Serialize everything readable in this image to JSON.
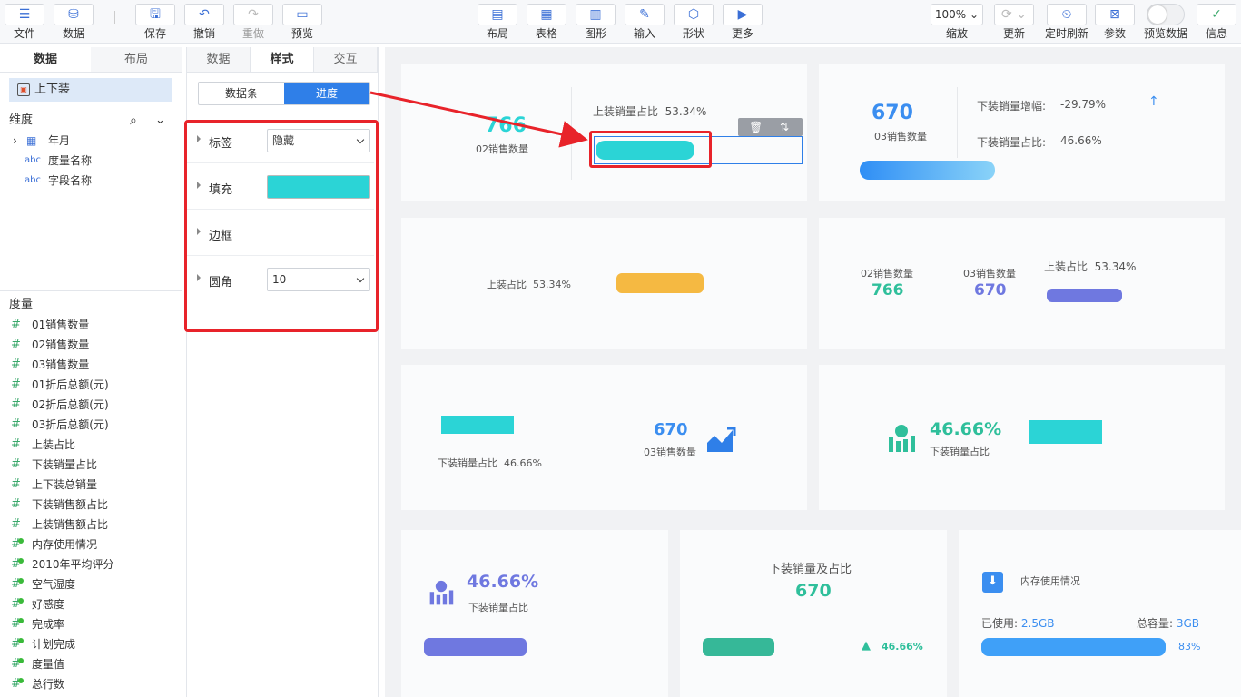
{
  "toolbar": {
    "file": "文件",
    "data": "数据",
    "save": "保存",
    "undo": "撤销",
    "redo": "重做",
    "preview": "预览",
    "layout": "布局",
    "table": "表格",
    "chart": "图形",
    "input": "输入",
    "shape": "形状",
    "more": "更多",
    "zoom_value": "100%",
    "zoom": "缩放",
    "refresh": "更新",
    "timed_refresh": "定时刷新",
    "params": "参数",
    "preview_data": "预览数据",
    "info": "信息"
  },
  "left_panel": {
    "tabs": [
      "数据",
      "布局"
    ],
    "dataset": "上下装",
    "dimension_title": "维度",
    "dimensions": [
      "年月",
      "度量名称",
      "字段名称"
    ],
    "measure_title": "度量",
    "measures": [
      "01销售数量",
      "02销售数量",
      "03销售数量",
      "01折后总额(元)",
      "02折后总额(元)",
      "03折后总额(元)",
      "上装占比",
      "下装销量占比",
      "上下装总销量",
      "下装销售额占比",
      "上装销售额占比",
      "内存使用情况",
      "2010年平均评分",
      "空气湿度",
      "好感度",
      "完成率",
      "计划完成",
      "度量值",
      "总行数"
    ]
  },
  "mid_panel": {
    "tabs": [
      "数据",
      "样式",
      "交互"
    ],
    "segments": [
      "数据条",
      "进度"
    ],
    "props": {
      "label": "标签",
      "label_value": "隐藏",
      "fill": "填充",
      "fill_color": "#2bd4d6",
      "border": "边框",
      "radius": "圆角",
      "radius_value": "10"
    }
  },
  "canvas": {
    "c1": {
      "num": "766",
      "label": "02销售数量",
      "ratio_label": "上装销量占比",
      "ratio_value": "53.34%",
      "progress": 0.5334
    },
    "c2": {
      "num": "670",
      "label": "03销售数量",
      "inc_label": "下装销量增幅:",
      "inc_value": "-29.79%",
      "ratio_label": "下装销量占比:",
      "ratio_value": "46.66%",
      "progress": 0.4666
    },
    "c3": {
      "ratio_label": "上装占比",
      "ratio_value": "53.34%",
      "progress": 0.5334
    },
    "c4": {
      "label_a": "02销售数量",
      "num_a": "766",
      "label_b": "03销售数量",
      "num_b": "670",
      "ratio_label": "上装占比",
      "ratio_value": "53.34%"
    },
    "c5": {
      "ratio_label": "下装销量占比",
      "ratio_value": "46.66%",
      "num": "670",
      "label": "03销售数量"
    },
    "c6": {
      "pct": "46.66%",
      "label": "下装销量占比"
    },
    "c7": {
      "pct": "46.66%",
      "label": "下装销量占比"
    },
    "c8": {
      "title": "下装销量及占比",
      "num": "670",
      "pct": "46.66%"
    },
    "c9": {
      "title": "内存使用情况",
      "used_label": "已使用:",
      "used_value": "2.5GB",
      "total_label": "总容量:",
      "total_value": "3GB",
      "pct": "83%",
      "progress": 0.83
    }
  },
  "colors": {
    "accent": "#2f7fe8",
    "cyan": "#2bd4d6",
    "teal": "#2fbf9b",
    "orange": "#f5b942",
    "purple": "#6f78e0",
    "red": "#e8232a"
  }
}
